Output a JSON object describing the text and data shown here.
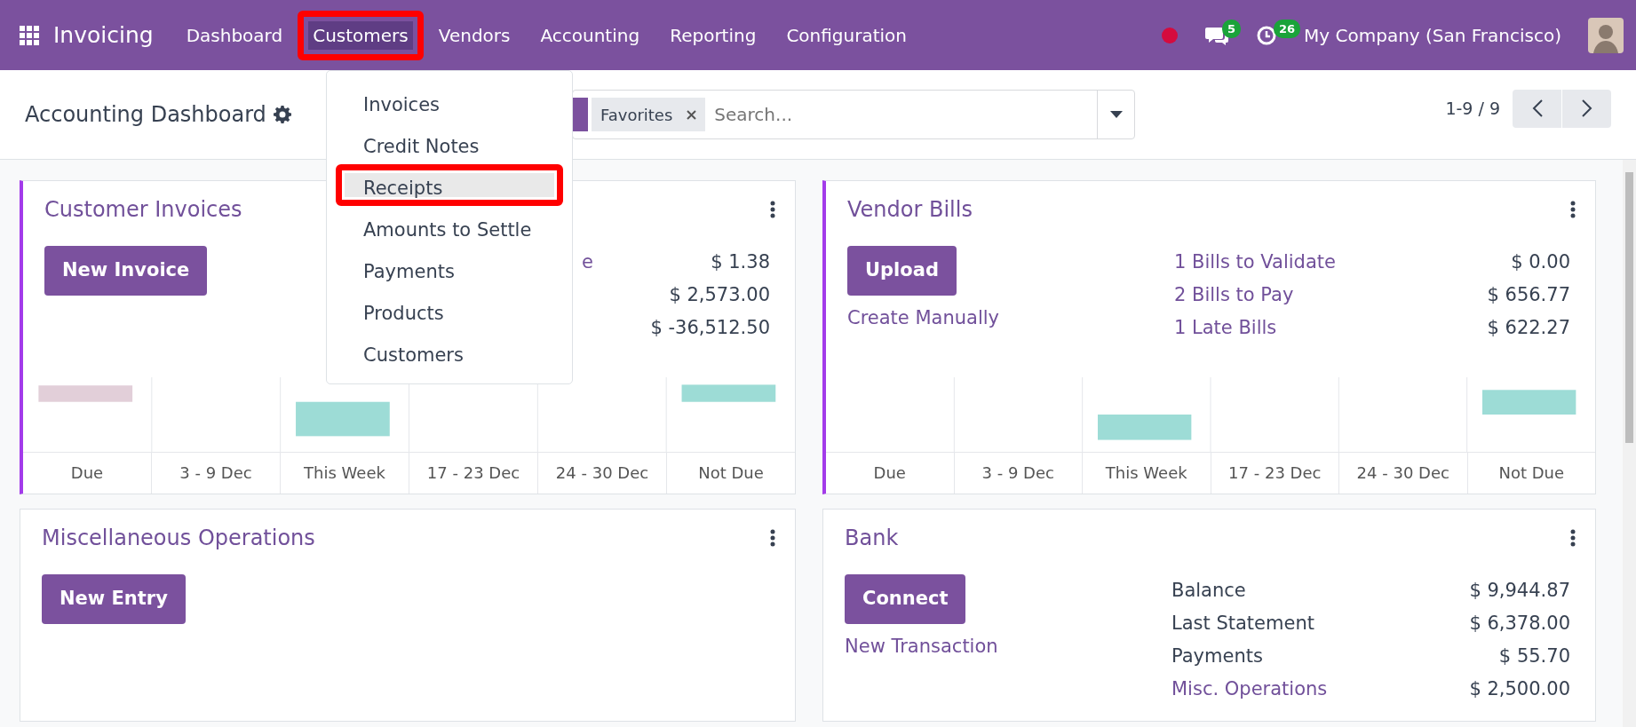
{
  "navbar": {
    "app_name": "Invoicing",
    "menus": [
      {
        "label": "Dashboard",
        "selected": false,
        "annotated": false
      },
      {
        "label": "Customers",
        "selected": true,
        "annotated": true
      },
      {
        "label": "Vendors",
        "selected": false,
        "annotated": false
      },
      {
        "label": "Accounting",
        "selected": false,
        "annotated": false
      },
      {
        "label": "Reporting",
        "selected": false,
        "annotated": false
      },
      {
        "label": "Configuration",
        "selected": false,
        "annotated": false
      }
    ],
    "messages_badge": "5",
    "activities_badge": "26",
    "company": "My Company (San Francisco)"
  },
  "customers_menu": {
    "items": [
      {
        "label": "Invoices",
        "selected": false,
        "annotated": false
      },
      {
        "label": "Credit Notes",
        "selected": false,
        "annotated": false
      },
      {
        "label": "Receipts",
        "selected": true,
        "annotated": true
      },
      {
        "label": "Amounts to Settle",
        "selected": false,
        "annotated": false
      },
      {
        "label": "Payments",
        "selected": false,
        "annotated": false
      },
      {
        "label": "Products",
        "selected": false,
        "annotated": false
      },
      {
        "label": "Customers",
        "selected": false,
        "annotated": false
      }
    ]
  },
  "control_panel": {
    "title": "Accounting Dashboard",
    "facet": "Favorites",
    "search_placeholder": "Search...",
    "pager": "1-9 / 9"
  },
  "journals": [
    {
      "kind": "sales",
      "title": "Customer Invoices",
      "button": "New Invoice",
      "stats": [
        {
          "label": "e",
          "link": true,
          "value": "$ 1.38"
        },
        {
          "value": "$ 2,573.00"
        },
        {
          "value": "$ -36,512.50"
        }
      ],
      "graph_labels": [
        "Due",
        "3 - 9 Dec",
        "This Week",
        "17 - 23 Dec",
        "24 - 30 Dec",
        "Not Due"
      ]
    },
    {
      "kind": "purchase",
      "title": "Vendor Bills",
      "button": "Upload",
      "link": "Create Manually",
      "stats": [
        {
          "label": "1 Bills to Validate",
          "link": true,
          "value": "$ 0.00"
        },
        {
          "label": "2 Bills to Pay",
          "link": true,
          "value": "$ 656.77"
        },
        {
          "label": "1 Late Bills",
          "link": true,
          "value": "$ 622.27"
        }
      ],
      "graph_labels": [
        "Due",
        "3 - 9 Dec",
        "This Week",
        "17 - 23 Dec",
        "24 - 30 Dec",
        "Not Due"
      ]
    },
    {
      "kind": "general",
      "title": "Miscellaneous Operations",
      "button": "New Entry"
    },
    {
      "kind": "bank",
      "title": "Bank",
      "button": "Connect",
      "link": "New Transaction",
      "stats": [
        {
          "label": "Balance",
          "link": false,
          "value": "$ 9,944.87"
        },
        {
          "label": "Last Statement",
          "link": false,
          "value": "$ 6,378.00"
        },
        {
          "label": "Payments",
          "link": false,
          "value": "$ 55.70"
        },
        {
          "label": "Misc. Operations",
          "link": true,
          "value": "$ 2,500.00"
        }
      ]
    }
  ]
}
